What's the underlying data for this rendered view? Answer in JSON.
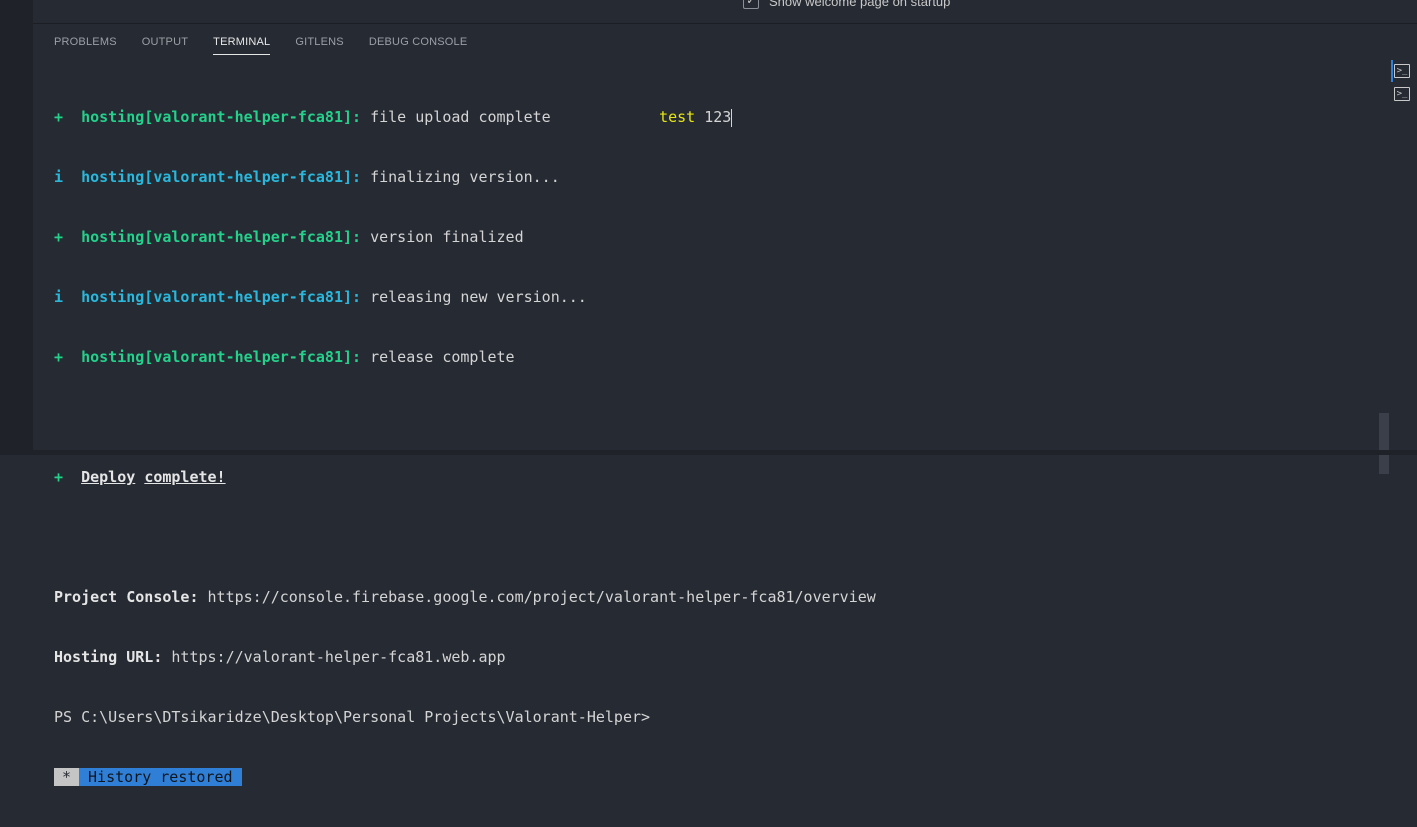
{
  "welcome": {
    "label": "Show welcome page on startup",
    "checked": true
  },
  "tabs": [
    {
      "label": "PROBLEMS"
    },
    {
      "label": "OUTPUT"
    },
    {
      "label": "TERMINAL",
      "active": true
    },
    {
      "label": "GITLENS"
    },
    {
      "label": "DEBUG CONSOLE"
    }
  ],
  "terminal": {
    "lines": [
      {
        "prefix": "+",
        "source": "hosting[valorant-helper-fca81]:",
        "text": " file upload complete",
        "extra": "test",
        "extra2": " 123"
      },
      {
        "prefix": "i",
        "source": "hosting[valorant-helper-fca81]:",
        "text": " finalizing version..."
      },
      {
        "prefix": "+",
        "source": "hosting[valorant-helper-fca81]:",
        "text": " version finalized"
      },
      {
        "prefix": "i",
        "source": "hosting[valorant-helper-fca81]:",
        "text": " releasing new version..."
      },
      {
        "prefix": "+",
        "source": "hosting[valorant-helper-fca81]:",
        "text": " release complete"
      }
    ],
    "deploy": {
      "prefix": "+",
      "word1": "Deploy",
      "word2": "complete!"
    },
    "console": {
      "label": "Project Console:",
      "url": " https://console.firebase.google.com/project/valorant-helper-fca81/overview"
    },
    "hosting": {
      "label": "Hosting URL:",
      "url": " https://valorant-helper-fca81.web.app"
    },
    "prompt": "PS C:\\Users\\DTsikaridze\\Desktop\\Personal Projects\\Valorant-Helper>",
    "restored": {
      "star": "*",
      "message": "History restored"
    }
  },
  "right_rail": {
    "icons": [
      "terminal-icon",
      "terminal-icon"
    ]
  },
  "colors": {
    "accent": "#2f7fd6",
    "green": "#23d18b",
    "cyan": "#29b8db",
    "yellow": "#e5e510",
    "background": "#262a33"
  }
}
